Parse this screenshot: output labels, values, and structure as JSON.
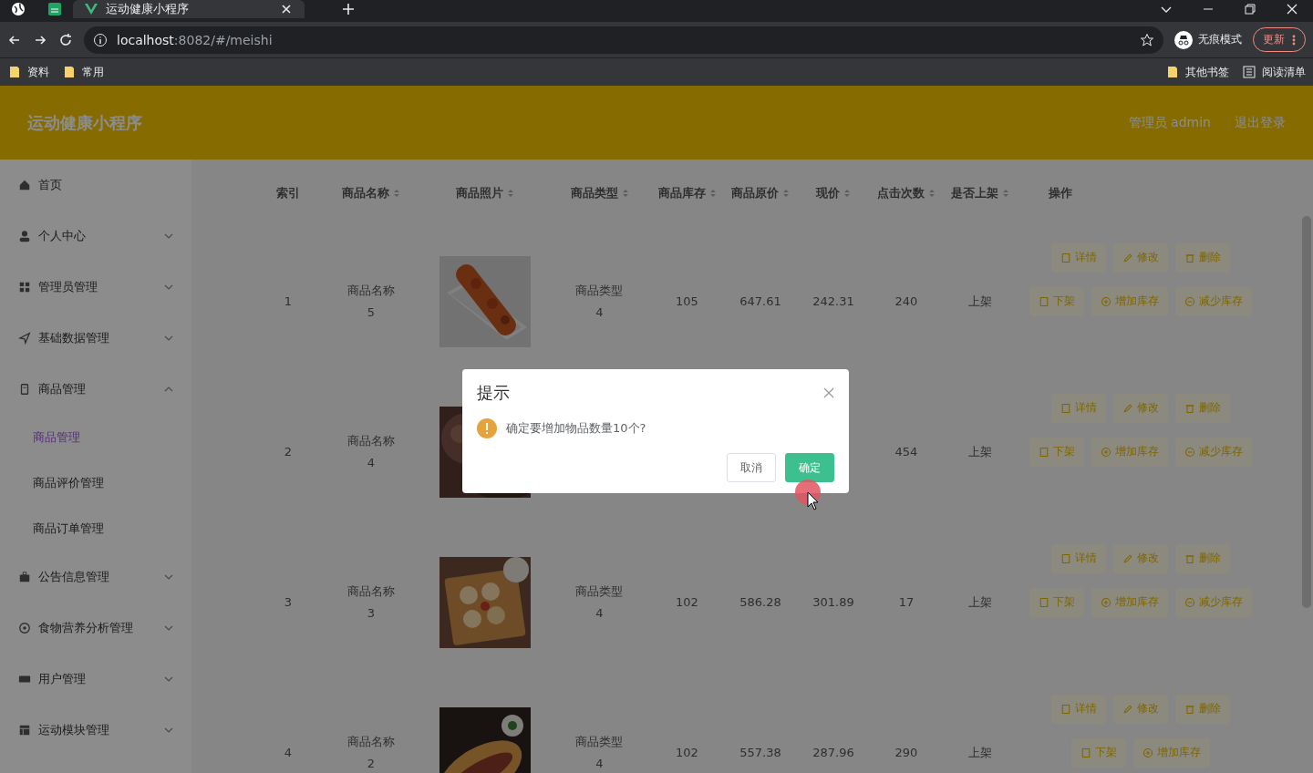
{
  "browser": {
    "tabs": [
      {
        "kind": "pinned",
        "selected": false
      },
      {
        "kind": "pinned",
        "selected": false
      },
      {
        "kind": "normal",
        "title": "运动健康小程序",
        "selected": true
      }
    ],
    "url_host": "localhost",
    "url_path": ":8082/#/meishi",
    "profile": "无痕模式",
    "update": "更新",
    "bookmarks": [
      "资料",
      "常用"
    ],
    "other_bookmarks": "其他书签",
    "reading_list": "阅读清单"
  },
  "app": {
    "title": "运动健康小程序",
    "user": "管理员 admin",
    "logout": "退出登录"
  },
  "sidebar": {
    "items": [
      {
        "label": "首页"
      },
      {
        "label": "个人中心",
        "expanded": false
      },
      {
        "label": "管理员管理",
        "expanded": false
      },
      {
        "label": "基础数据管理",
        "expanded": false
      },
      {
        "label": "商品管理",
        "expanded": true,
        "children": [
          {
            "label": "商品管理",
            "selected": true
          },
          {
            "label": "商品评价管理",
            "selected": false
          },
          {
            "label": "商品订单管理",
            "selected": false
          }
        ]
      },
      {
        "label": "公告信息管理",
        "expanded": false
      },
      {
        "label": "食物营养分析管理",
        "expanded": false
      },
      {
        "label": "用户管理",
        "expanded": false
      },
      {
        "label": "运动模块管理",
        "expanded": false
      }
    ]
  },
  "table": {
    "columns": [
      {
        "label": "索引",
        "sortable": false
      },
      {
        "label": "商品名称",
        "sortable": true
      },
      {
        "label": "商品照片",
        "sortable": true
      },
      {
        "label": "商品类型",
        "sortable": true
      },
      {
        "label": "商品库存",
        "sortable": true
      },
      {
        "label": "商品原价",
        "sortable": true
      },
      {
        "label": "现价",
        "sortable": true
      },
      {
        "label": "点击次数",
        "sortable": true
      },
      {
        "label": "是否上架",
        "sortable": true
      },
      {
        "label": "操作",
        "sortable": false
      }
    ],
    "rows": [
      {
        "cells": [
          "1",
          "商品名称5",
          {
            "kind": "picture"
          },
          "商品类型4",
          "105",
          "647.61",
          "242.31",
          "240",
          "上架"
        ],
        "actions": [
          "详情",
          "修改",
          "删除",
          "下架",
          "增加库存",
          "减少库存"
        ]
      },
      {
        "cells": [
          "2",
          "商品名称4",
          {
            "kind": "picture"
          },
          null,
          null,
          null,
          null,
          "454",
          "上架"
        ],
        "actions": [
          "详情",
          "修改",
          "删除",
          "下架",
          "增加库存",
          "减少库存"
        ]
      },
      {
        "cells": [
          "3",
          "商品名称3",
          {
            "kind": "picture"
          },
          "商品类型4",
          "102",
          "586.28",
          "301.89",
          "17",
          "上架"
        ],
        "actions": [
          "详情",
          "修改",
          "删除",
          "下架",
          "增加库存",
          "减少库存"
        ]
      },
      {
        "cells": [
          "4",
          "商品名称2",
          {
            "kind": "picture"
          },
          "商品类型4",
          "102",
          "557.38",
          "287.96",
          "290",
          "上架"
        ],
        "actions": [
          "详情",
          "修改",
          "删除",
          "下架",
          "增加库存"
        ]
      }
    ]
  },
  "dialog": {
    "title": "提示",
    "message": "确定要增加物品数量10个?",
    "buttons": [
      {
        "label": "取消",
        "kind": "default"
      },
      {
        "label": "确定",
        "kind": "primary"
      }
    ]
  }
}
